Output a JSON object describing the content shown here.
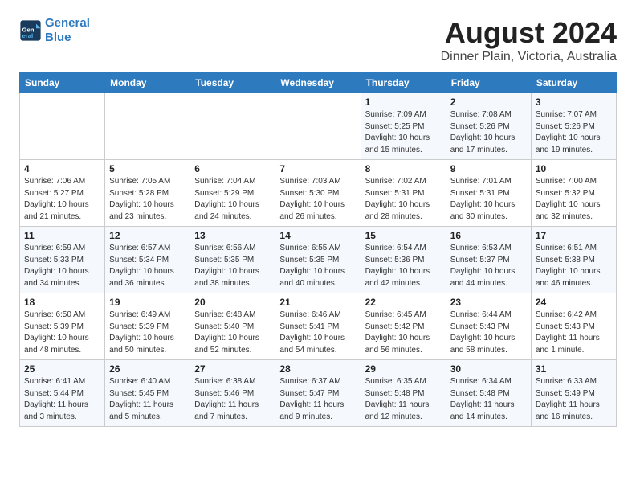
{
  "header": {
    "logo_line1": "General",
    "logo_line2": "Blue",
    "title": "August 2024",
    "subtitle": "Dinner Plain, Victoria, Australia"
  },
  "days_of_week": [
    "Sunday",
    "Monday",
    "Tuesday",
    "Wednesday",
    "Thursday",
    "Friday",
    "Saturday"
  ],
  "weeks": [
    [
      {
        "day": "",
        "sunrise": "",
        "sunset": "",
        "daylight": ""
      },
      {
        "day": "",
        "sunrise": "",
        "sunset": "",
        "daylight": ""
      },
      {
        "day": "",
        "sunrise": "",
        "sunset": "",
        "daylight": ""
      },
      {
        "day": "",
        "sunrise": "",
        "sunset": "",
        "daylight": ""
      },
      {
        "day": "1",
        "sunrise": "Sunrise: 7:09 AM",
        "sunset": "Sunset: 5:25 PM",
        "daylight": "Daylight: 10 hours and 15 minutes."
      },
      {
        "day": "2",
        "sunrise": "Sunrise: 7:08 AM",
        "sunset": "Sunset: 5:26 PM",
        "daylight": "Daylight: 10 hours and 17 minutes."
      },
      {
        "day": "3",
        "sunrise": "Sunrise: 7:07 AM",
        "sunset": "Sunset: 5:26 PM",
        "daylight": "Daylight: 10 hours and 19 minutes."
      }
    ],
    [
      {
        "day": "4",
        "sunrise": "Sunrise: 7:06 AM",
        "sunset": "Sunset: 5:27 PM",
        "daylight": "Daylight: 10 hours and 21 minutes."
      },
      {
        "day": "5",
        "sunrise": "Sunrise: 7:05 AM",
        "sunset": "Sunset: 5:28 PM",
        "daylight": "Daylight: 10 hours and 23 minutes."
      },
      {
        "day": "6",
        "sunrise": "Sunrise: 7:04 AM",
        "sunset": "Sunset: 5:29 PM",
        "daylight": "Daylight: 10 hours and 24 minutes."
      },
      {
        "day": "7",
        "sunrise": "Sunrise: 7:03 AM",
        "sunset": "Sunset: 5:30 PM",
        "daylight": "Daylight: 10 hours and 26 minutes."
      },
      {
        "day": "8",
        "sunrise": "Sunrise: 7:02 AM",
        "sunset": "Sunset: 5:31 PM",
        "daylight": "Daylight: 10 hours and 28 minutes."
      },
      {
        "day": "9",
        "sunrise": "Sunrise: 7:01 AM",
        "sunset": "Sunset: 5:31 PM",
        "daylight": "Daylight: 10 hours and 30 minutes."
      },
      {
        "day": "10",
        "sunrise": "Sunrise: 7:00 AM",
        "sunset": "Sunset: 5:32 PM",
        "daylight": "Daylight: 10 hours and 32 minutes."
      }
    ],
    [
      {
        "day": "11",
        "sunrise": "Sunrise: 6:59 AM",
        "sunset": "Sunset: 5:33 PM",
        "daylight": "Daylight: 10 hours and 34 minutes."
      },
      {
        "day": "12",
        "sunrise": "Sunrise: 6:57 AM",
        "sunset": "Sunset: 5:34 PM",
        "daylight": "Daylight: 10 hours and 36 minutes."
      },
      {
        "day": "13",
        "sunrise": "Sunrise: 6:56 AM",
        "sunset": "Sunset: 5:35 PM",
        "daylight": "Daylight: 10 hours and 38 minutes."
      },
      {
        "day": "14",
        "sunrise": "Sunrise: 6:55 AM",
        "sunset": "Sunset: 5:35 PM",
        "daylight": "Daylight: 10 hours and 40 minutes."
      },
      {
        "day": "15",
        "sunrise": "Sunrise: 6:54 AM",
        "sunset": "Sunset: 5:36 PM",
        "daylight": "Daylight: 10 hours and 42 minutes."
      },
      {
        "day": "16",
        "sunrise": "Sunrise: 6:53 AM",
        "sunset": "Sunset: 5:37 PM",
        "daylight": "Daylight: 10 hours and 44 minutes."
      },
      {
        "day": "17",
        "sunrise": "Sunrise: 6:51 AM",
        "sunset": "Sunset: 5:38 PM",
        "daylight": "Daylight: 10 hours and 46 minutes."
      }
    ],
    [
      {
        "day": "18",
        "sunrise": "Sunrise: 6:50 AM",
        "sunset": "Sunset: 5:39 PM",
        "daylight": "Daylight: 10 hours and 48 minutes."
      },
      {
        "day": "19",
        "sunrise": "Sunrise: 6:49 AM",
        "sunset": "Sunset: 5:39 PM",
        "daylight": "Daylight: 10 hours and 50 minutes."
      },
      {
        "day": "20",
        "sunrise": "Sunrise: 6:48 AM",
        "sunset": "Sunset: 5:40 PM",
        "daylight": "Daylight: 10 hours and 52 minutes."
      },
      {
        "day": "21",
        "sunrise": "Sunrise: 6:46 AM",
        "sunset": "Sunset: 5:41 PM",
        "daylight": "Daylight: 10 hours and 54 minutes."
      },
      {
        "day": "22",
        "sunrise": "Sunrise: 6:45 AM",
        "sunset": "Sunset: 5:42 PM",
        "daylight": "Daylight: 10 hours and 56 minutes."
      },
      {
        "day": "23",
        "sunrise": "Sunrise: 6:44 AM",
        "sunset": "Sunset: 5:43 PM",
        "daylight": "Daylight: 10 hours and 58 minutes."
      },
      {
        "day": "24",
        "sunrise": "Sunrise: 6:42 AM",
        "sunset": "Sunset: 5:43 PM",
        "daylight": "Daylight: 11 hours and 1 minute."
      }
    ],
    [
      {
        "day": "25",
        "sunrise": "Sunrise: 6:41 AM",
        "sunset": "Sunset: 5:44 PM",
        "daylight": "Daylight: 11 hours and 3 minutes."
      },
      {
        "day": "26",
        "sunrise": "Sunrise: 6:40 AM",
        "sunset": "Sunset: 5:45 PM",
        "daylight": "Daylight: 11 hours and 5 minutes."
      },
      {
        "day": "27",
        "sunrise": "Sunrise: 6:38 AM",
        "sunset": "Sunset: 5:46 PM",
        "daylight": "Daylight: 11 hours and 7 minutes."
      },
      {
        "day": "28",
        "sunrise": "Sunrise: 6:37 AM",
        "sunset": "Sunset: 5:47 PM",
        "daylight": "Daylight: 11 hours and 9 minutes."
      },
      {
        "day": "29",
        "sunrise": "Sunrise: 6:35 AM",
        "sunset": "Sunset: 5:48 PM",
        "daylight": "Daylight: 11 hours and 12 minutes."
      },
      {
        "day": "30",
        "sunrise": "Sunrise: 6:34 AM",
        "sunset": "Sunset: 5:48 PM",
        "daylight": "Daylight: 11 hours and 14 minutes."
      },
      {
        "day": "31",
        "sunrise": "Sunrise: 6:33 AM",
        "sunset": "Sunset: 5:49 PM",
        "daylight": "Daylight: 11 hours and 16 minutes."
      }
    ]
  ]
}
